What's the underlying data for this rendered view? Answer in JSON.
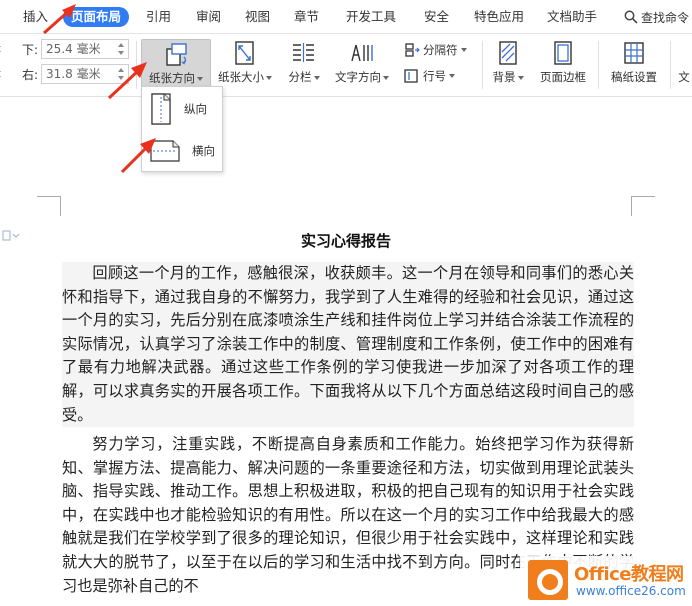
{
  "menu": {
    "items": [
      "插入",
      "页面布局",
      "引用",
      "审阅",
      "视图",
      "章节",
      "开发工具",
      "安全",
      "特色应用",
      "文档助手"
    ],
    "active": "页面布局",
    "search_label": "查找命令"
  },
  "ribbon": {
    "margins": [
      {
        "label": "下:",
        "value": "25.4 毫米"
      },
      {
        "label": "右:",
        "value": "31.8 毫米"
      }
    ],
    "orientation_label": "纸张方向",
    "size_label": "纸张大小",
    "columns_label": "分栏",
    "text_direction_label": "文字方向",
    "separator_label": "分隔符",
    "line_number_label": "行号",
    "background_label": "背景",
    "page_border_label": "页面边框",
    "draft_paper_label": "稿纸设置",
    "cut_label": "文"
  },
  "orientation_menu": {
    "portrait_label": "纵向",
    "landscape_label": "横向"
  },
  "document": {
    "title": "实习心得报告",
    "paragraphs": [
      "回顾这一个月的工作，感触很深，收获颇丰。这一个月在领导和同事们的悉心关怀和指导下，通过我自身的不懈努力，我学到了人生难得的经验和社会见识，通过这一个月的实习，先后分别在底漆喷涂生产线和挂件岗位上学习并结合涂装工作流程的实际情况，认真学习了涂装工作中的制度、管理制度和工作条例，使工作中的困难有了最有力地解决武器。通过这些工作条例的学习使我进一步加深了对各项工作的理解，可以求真务实的开展各项工作。下面我将从以下几个方面总结这段时间自己的感受。",
      "努力学习，注重实践，不断提高自身素质和工作能力。始终把学习作为获得新知、掌握方法、提高能力、解决问题的一条重要途径和方法，切实做到用理论武装头脑、指导实践、推动工作。思想上积极进取，积极的把自己现有的知识用于社会实践中，在实践中也才能检验知识的有用性。所以在这一个月的实习工作中给我最大的感触就是我们在学校学到了很多的理论知识，但很少用于社会实践中，这样理论和实践就大大的脱节了，以至于在以后的学习和生活中找不到方向。同时在工作中不断的学习也是弥补自己的不"
    ]
  },
  "watermark": {
    "brand": "Office教程网",
    "url": "www.office26.com"
  },
  "colors": {
    "accent": "#2f7cf6",
    "arrow": "#e8321e",
    "logo_orange": "#f07e1c",
    "logo_blue": "#3b7fd8"
  }
}
